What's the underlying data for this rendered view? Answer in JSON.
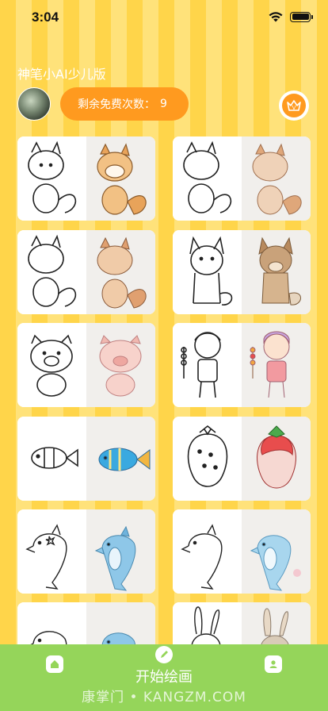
{
  "status_bar": {
    "time": "3:04"
  },
  "header": {
    "app_title": "神笔小AI少儿版",
    "free_count_label": "剩余免费次数：",
    "free_count_value": "9",
    "vip_label": "V"
  },
  "gallery": {
    "items": [
      {
        "subject": "fox",
        "color": "#e8a35a"
      },
      {
        "subject": "fox",
        "color": "#dfa77a"
      },
      {
        "subject": "fox",
        "color": "#e0a070"
      },
      {
        "subject": "dog",
        "color": "#c9a27a"
      },
      {
        "subject": "pig",
        "color": "#f0b8b0"
      },
      {
        "subject": "boy-with-candied-haws",
        "color": "#f29aa0"
      },
      {
        "subject": "fish",
        "color": "#3aa9e0"
      },
      {
        "subject": "strawberry",
        "color": "#e84d4d"
      },
      {
        "subject": "dolphin",
        "color": "#8ec7e8"
      },
      {
        "subject": "dolphin",
        "color": "#a8d6ee"
      },
      {
        "subject": "dolphin",
        "color": "#8ec7e8"
      },
      {
        "subject": "rabbit",
        "color": "#d9cbb8"
      }
    ]
  },
  "bottom_nav": {
    "home_icon": "home-icon",
    "draw_icon": "pencil-icon",
    "draw_label": "开始绘画",
    "profile_icon": "user-icon",
    "watermark": "康掌门 • KANGZM.COM"
  },
  "colors": {
    "background_stripe_a": "#ffd54a",
    "background_stripe_b": "#ffe27a",
    "accent_orange": "#ff9a1f",
    "nav_green": "#95d55a"
  }
}
